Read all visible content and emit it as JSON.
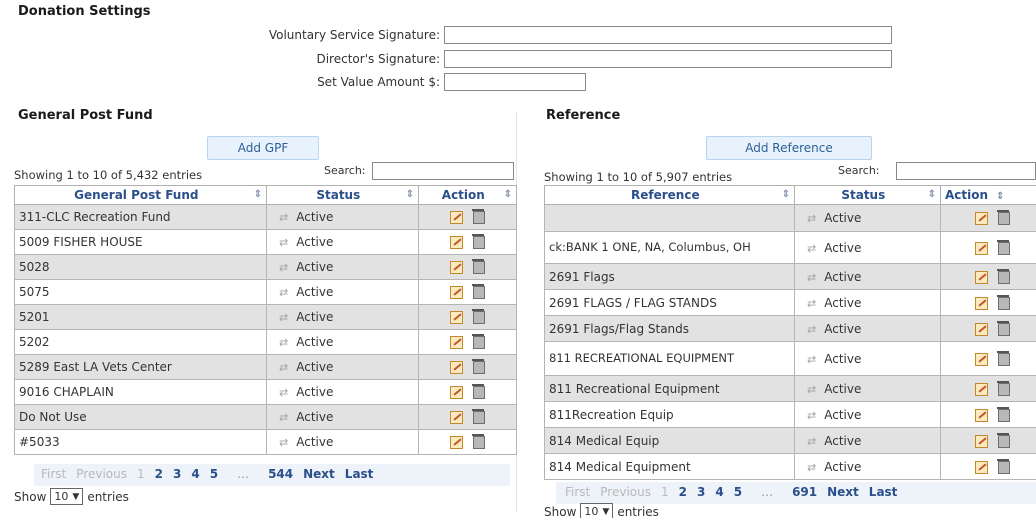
{
  "donation": {
    "title": "Donation Settings",
    "voluntary_label": "Voluntary Service Signature:",
    "director_label": "Director's Signature:",
    "value_label": "Set Value Amount $:"
  },
  "gpf": {
    "title": "General Post Fund",
    "add_button": "Add GPF",
    "info": "Showing 1 to 10 of 5,432 entries",
    "search_label": "Search:",
    "columns": [
      "General Post Fund",
      "Status",
      "Action"
    ],
    "rows": [
      {
        "name": "311-CLC Recreation Fund",
        "status": "Active"
      },
      {
        "name": "5009 FISHER HOUSE",
        "status": "Active"
      },
      {
        "name": "5028",
        "status": "Active"
      },
      {
        "name": "5075",
        "status": "Active"
      },
      {
        "name": "5201",
        "status": "Active"
      },
      {
        "name": "5202",
        "status": "Active"
      },
      {
        "name": "5289 East LA Vets Center",
        "status": "Active"
      },
      {
        "name": "9016 CHAPLAIN",
        "status": "Active"
      },
      {
        "name": "Do Not Use",
        "status": "Active"
      },
      {
        "name": "#5033",
        "status": "Active"
      }
    ],
    "pager": {
      "first": "First",
      "previous": "Previous",
      "pages": [
        "1",
        "2",
        "3",
        "4",
        "5"
      ],
      "ellipsis": "…",
      "last_page": "544",
      "next": "Next",
      "last": "Last"
    },
    "length": {
      "show": "Show",
      "value": "10",
      "entries": "entries"
    }
  },
  "ref": {
    "title": "Reference",
    "add_button": "Add Reference",
    "info": "Showing 1 to 10 of 5,907 entries",
    "search_label": "Search:",
    "columns": [
      "Reference",
      "Status",
      "Action"
    ],
    "rows": [
      {
        "name": "",
        "status": "Active"
      },
      {
        "name": "ck:BANK 1 ONE, NA, Columbus, OH",
        "status": "Active"
      },
      {
        "name": "2691 Flags",
        "status": "Active"
      },
      {
        "name": "2691 FLAGS / FLAG STANDS",
        "status": "Active"
      },
      {
        "name": "2691 Flags/Flag Stands",
        "status": "Active"
      },
      {
        "name": "811 RECREATIONAL EQUIPMENT",
        "status": "Active"
      },
      {
        "name": "811 Recreational Equipment",
        "status": "Active"
      },
      {
        "name": "811Recreation Equip",
        "status": "Active"
      },
      {
        "name": "814 Medical Equip",
        "status": "Active"
      },
      {
        "name": "814 Medical Equipment",
        "status": "Active"
      }
    ],
    "pager": {
      "first": "First",
      "previous": "Previous",
      "pages": [
        "1",
        "2",
        "3",
        "4",
        "5"
      ],
      "ellipsis": "…",
      "last_page": "691",
      "next": "Next",
      "last": "Last"
    },
    "length": {
      "show": "Show",
      "value": "10",
      "entries": "entries"
    }
  },
  "icons": {
    "status_arrow": "swap-arrow-icon",
    "edit": "edit-icon",
    "delete": "trash-icon",
    "sort": "sort-icon"
  }
}
